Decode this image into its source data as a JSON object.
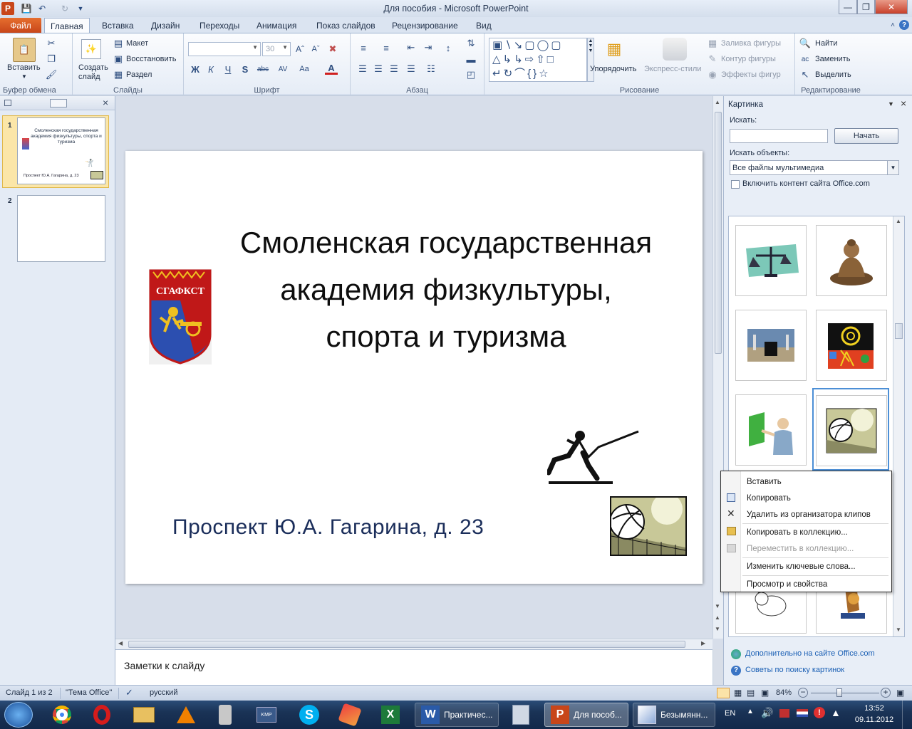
{
  "window": {
    "title": "Для пособия - Microsoft PowerPoint"
  },
  "tabs": {
    "file": "Файл",
    "items": [
      "Главная",
      "Вставка",
      "Дизайн",
      "Переходы",
      "Анимация",
      "Показ слайдов",
      "Рецензирование",
      "Вид"
    ],
    "active": "Главная"
  },
  "ribbon": {
    "clipboard": {
      "label": "Буфер обмена",
      "paste": "Вставить"
    },
    "slides": {
      "label": "Слайды",
      "new_slide": "Создать слайд",
      "layout": "Макет",
      "reset": "Восстановить",
      "section": "Раздел"
    },
    "font": {
      "label": "Шрифт",
      "size": "30"
    },
    "paragraph": {
      "label": "Абзац"
    },
    "drawing": {
      "label": "Рисование",
      "arrange": "Упорядочить",
      "quick_styles": "Экспресс-стили",
      "fill": "Заливка фигуры",
      "outline": "Контур фигуры",
      "effects": "Эффекты фигур"
    },
    "editing": {
      "label": "Редактирование",
      "find": "Найти",
      "replace": "Заменить",
      "select": "Выделить"
    }
  },
  "slides_panel": {
    "slide1_number": "1",
    "slide2_number": "2",
    "thumb_title": "Смоленская государственная академия физкультуры, спорта и туризма",
    "thumb_address": "Проспект Ю.А. Гагарина, д. 23"
  },
  "slide": {
    "title_line1": "Смоленская государственная",
    "title_line2": "академия физкультуры,",
    "title_line3": "спорта и туризма",
    "emblem_text": "СГАФКСТ",
    "address": "Проспект Ю.А. Гагарина, д. 23"
  },
  "notes": {
    "placeholder": "Заметки к слайду"
  },
  "clipart_pane": {
    "title": "Картинка",
    "search_label": "Искать:",
    "search_value": "",
    "go_button": "Начать",
    "results_label": "Искать объекты:",
    "results_value": "Все файлы мультимедиа",
    "include_online": "Включить контент сайта Office.com",
    "more_link": "Дополнительно на сайте Office.com",
    "tips_link": "Советы по поиску картинок"
  },
  "context_menu": {
    "items": [
      {
        "label": "Вставить",
        "enabled": true
      },
      {
        "label": "Копировать",
        "enabled": true
      },
      {
        "label": "Удалить из организатора клипов",
        "enabled": true
      },
      {
        "label": "Копировать в коллекцию...",
        "enabled": true
      },
      {
        "label": "Переместить в коллекцию...",
        "enabled": false
      },
      {
        "label": "Изменить ключевые слова...",
        "enabled": true
      },
      {
        "label": "Просмотр и свойства",
        "enabled": true
      }
    ]
  },
  "status": {
    "slide_info": "Слайд 1 из 2",
    "theme": "\"Тема Office\"",
    "language": "русский",
    "zoom": "84%"
  },
  "taskbar": {
    "items": [
      "Практичес...",
      "Для пособ...",
      "Безымянн..."
    ],
    "lang": "EN",
    "time": "13:52",
    "date": "09.11.2012"
  },
  "colors": {
    "accent": "#c8461a",
    "ribbon": "#dbe4f1",
    "selection": "#4c8fd6"
  }
}
